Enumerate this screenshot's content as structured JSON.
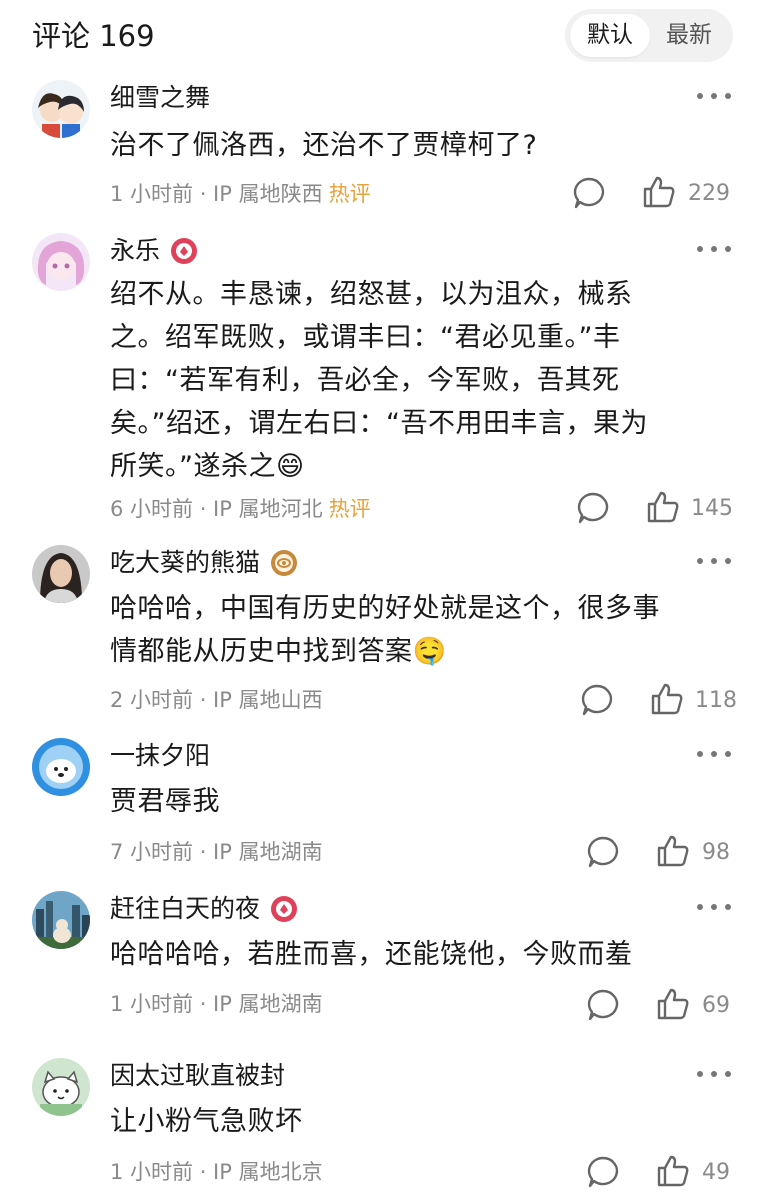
{
  "header": {
    "title": "评论 169",
    "sort_default": "默认",
    "sort_latest": "最新"
  },
  "colors": {
    "hot": "#e6a23c",
    "meta": "#8a8a8a",
    "badge_red": "#e0415a",
    "badge_gold": "#c8893a"
  },
  "comments": [
    {
      "name": "细雪之舞",
      "text": "治不了佩洛西，还治不了贾樟柯了?",
      "time": "1 小时前 · IP 属地陕西",
      "hot": "热评",
      "likes": "229",
      "avatar_icon": "anime-duo-avatar"
    },
    {
      "name": "永乐",
      "text": "绍不从。丰恳谏，绍怒甚，以为沮众，械系\n之。绍军既败，或谓丰曰：“君必见重。”丰\n曰：“若军有利，吾必全，今军败，吾其死\n矣。”绍还，谓左右曰：“吾不用田丰言，果为\n所笑。”遂杀之",
      "emoji": "😄",
      "time": "6 小时前 · IP 属地河北",
      "hot": "热评",
      "likes": "145",
      "avatar_icon": "anime-girl-avatar",
      "badge": "red-medal-icon"
    },
    {
      "name": "吃大葵的熊猫",
      "text": "哈哈哈，中国有历史的好处就是这个，很多事\n情都能从历史中找到答案",
      "emoji": "🤤",
      "time": "2 小时前 · IP 属地山西",
      "likes": "118",
      "avatar_icon": "portrait-avatar",
      "badge": "eye-medal-icon"
    },
    {
      "name": "一抹夕阳",
      "text": "贾君辱我",
      "time": "7 小时前 · IP 属地湖南",
      "likes": "98",
      "avatar_icon": "cartoon-dog-avatar"
    },
    {
      "name": "赶往白天的夜",
      "text": "哈哈哈哈，若胜而喜，还能饶他，今败而羞",
      "time": "1 小时前 · IP 属地湖南",
      "likes": "69",
      "avatar_icon": "city-cat-avatar",
      "badge": "red-medal-icon"
    },
    {
      "name": "因太过耿直被封",
      "text": "让小粉气急败坏",
      "time": "1 小时前 · IP 属地北京",
      "likes": "49",
      "avatar_icon": "cartoon-cat-avatar"
    }
  ]
}
